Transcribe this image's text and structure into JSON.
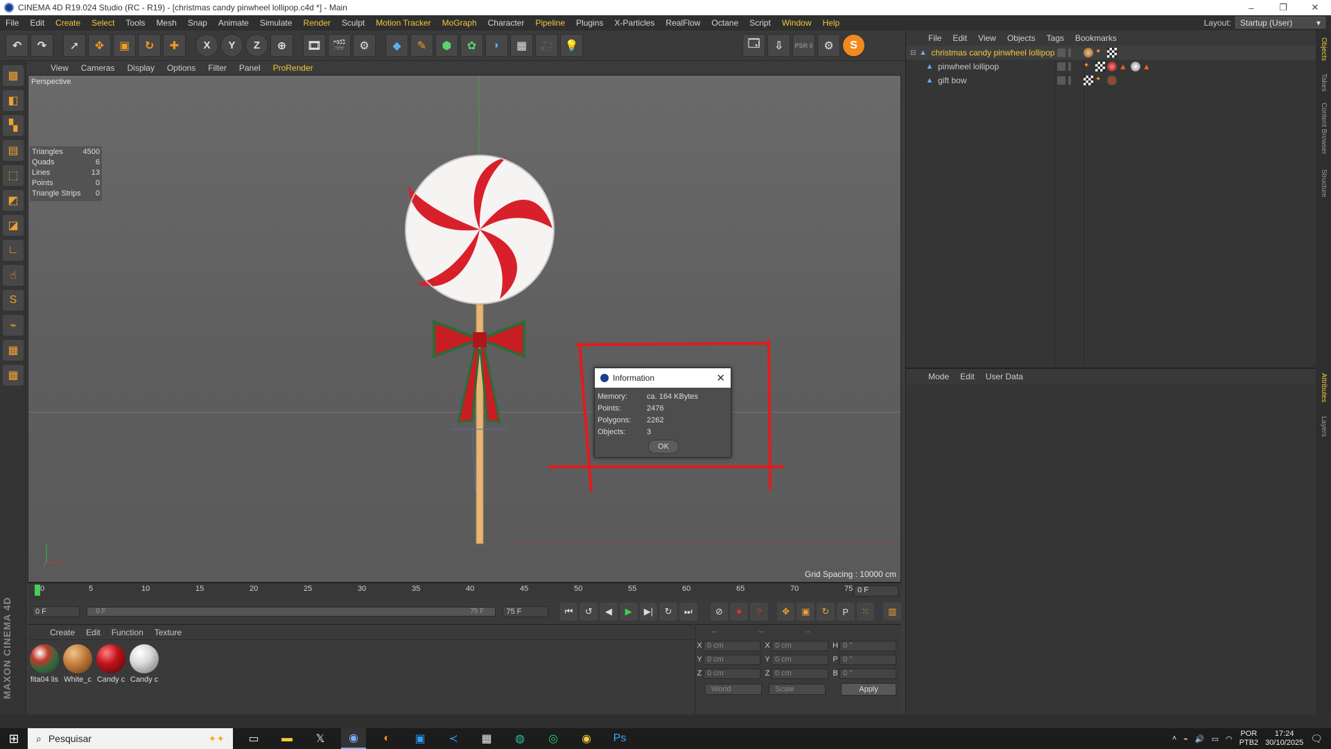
{
  "window": {
    "title": "CINEMA 4D R19.024 Studio (RC - R19) - [christmas candy pinwheel lollipop.c4d *] - Main",
    "min": "–",
    "restore": "❐",
    "close": "✕"
  },
  "menubar": {
    "items": [
      {
        "label": "File",
        "hl": false
      },
      {
        "label": "Edit",
        "hl": false
      },
      {
        "label": "Create",
        "hl": true
      },
      {
        "label": "Select",
        "hl": true
      },
      {
        "label": "Tools",
        "hl": false
      },
      {
        "label": "Mesh",
        "hl": false
      },
      {
        "label": "Snap",
        "hl": false
      },
      {
        "label": "Animate",
        "hl": false
      },
      {
        "label": "Simulate",
        "hl": false
      },
      {
        "label": "Render",
        "hl": true
      },
      {
        "label": "Sculpt",
        "hl": false
      },
      {
        "label": "Motion Tracker",
        "hl": true
      },
      {
        "label": "MoGraph",
        "hl": true
      },
      {
        "label": "Character",
        "hl": false
      },
      {
        "label": "Pipeline",
        "hl": true
      },
      {
        "label": "Plugins",
        "hl": false
      },
      {
        "label": "X-Particles",
        "hl": false
      },
      {
        "label": "RealFlow",
        "hl": false
      },
      {
        "label": "Octane",
        "hl": false
      },
      {
        "label": "Script",
        "hl": false
      },
      {
        "label": "Window",
        "hl": true
      },
      {
        "label": "Help",
        "hl": true
      }
    ],
    "layout_label": "Layout:",
    "layout_value": "Startup (User)"
  },
  "toolbar": {
    "axis_x": "X",
    "axis_y": "Y",
    "axis_z": "Z",
    "psr": "PSR 0"
  },
  "viewport": {
    "menu": [
      {
        "label": "View",
        "hl": false
      },
      {
        "label": "Cameras",
        "hl": false
      },
      {
        "label": "Display",
        "hl": false
      },
      {
        "label": "Options",
        "hl": false
      },
      {
        "label": "Filter",
        "hl": false
      },
      {
        "label": "Panel",
        "hl": false
      },
      {
        "label": "ProRender",
        "hl": true
      }
    ],
    "label": "Perspective",
    "stats": [
      {
        "k": "Triangles",
        "v": "4500"
      },
      {
        "k": "Quads",
        "v": "6"
      },
      {
        "k": "Lines",
        "v": "13"
      },
      {
        "k": "Points",
        "v": "0"
      },
      {
        "k": "Triangle Strips",
        "v": "0"
      }
    ],
    "grid_spacing": "Grid Spacing : 10000 cm"
  },
  "dialog": {
    "title": "Information",
    "rows": [
      {
        "k": "Memory:",
        "v": "ca. 164 KBytes"
      },
      {
        "k": "Points:",
        "v": "2476"
      },
      {
        "k": "Polygons:",
        "v": "2262"
      },
      {
        "k": "Objects:",
        "v": "3"
      }
    ],
    "ok": "OK"
  },
  "timeline": {
    "ticks": [
      "0",
      "5",
      "10",
      "15",
      "20",
      "25",
      "30",
      "35",
      "40",
      "45",
      "50",
      "55",
      "60",
      "65",
      "70",
      "75"
    ],
    "current_frame": "0 F",
    "start_field": "0 F",
    "slider_left": "0 F",
    "slider_right": "75 F",
    "end_field": "75 F"
  },
  "material_manager": {
    "menu": [
      "Create",
      "Edit",
      "Function",
      "Texture"
    ],
    "materials": [
      {
        "name": "fita04 lis",
        "color": "#c0392b"
      },
      {
        "name": "White_c",
        "color": "#c07a3a"
      },
      {
        "name": "Candy c",
        "color": "#c0141b"
      },
      {
        "name": "Candy c",
        "color": "#d9d9d9"
      }
    ]
  },
  "coordinates": {
    "header": [
      "--",
      "--",
      "--"
    ],
    "rows": [
      {
        "a": "X",
        "av": "0 cm",
        "b": "X",
        "bv": "0 cm",
        "c": "H",
        "cv": "0 °"
      },
      {
        "a": "Y",
        "av": "0 cm",
        "b": "Y",
        "bv": "0 cm",
        "c": "P",
        "cv": "0 °"
      },
      {
        "a": "Z",
        "av": "0 cm",
        "b": "Z",
        "bv": "0 cm",
        "c": "B",
        "cv": "0 °"
      }
    ],
    "world": "World",
    "scale": "Scale",
    "apply": "Apply"
  },
  "object_manager": {
    "menu": [
      "File",
      "Edit",
      "View",
      "Objects",
      "Tags",
      "Bookmarks"
    ],
    "objects": [
      {
        "name": "christmas candy pinwheel lollipop",
        "selected": true
      },
      {
        "name": "pinwheel lollipop",
        "selected": false
      },
      {
        "name": "gift bow",
        "selected": false
      }
    ]
  },
  "attribute_manager": {
    "menu": [
      "Mode",
      "Edit",
      "User Data"
    ]
  },
  "side_tabs": [
    "Objects",
    "Takes",
    "Content Browser",
    "Structure",
    "Attributes",
    "Layers"
  ],
  "brand": "MAXON CINEMA 4D",
  "taskbar": {
    "search_placeholder": "Pesquisar",
    "lang_top": "POR",
    "lang_bottom": "PTB2",
    "time": "17:24",
    "date": "30/10/2025"
  },
  "colors": {
    "accent_yellow": "#f2c73a",
    "annotation_red": "#e31b1b",
    "candy_red": "#d8202b",
    "stick": "#e8b878"
  }
}
